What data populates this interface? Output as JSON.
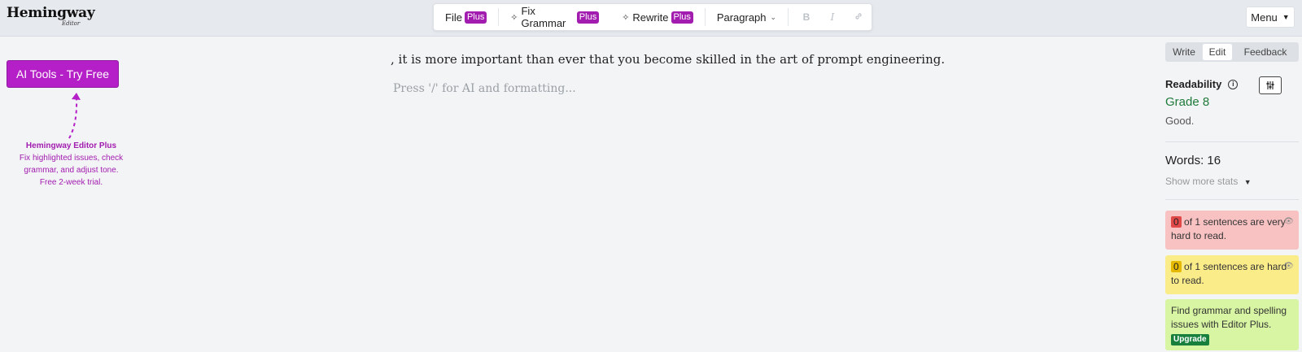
{
  "app": {
    "logo": "Hemingway",
    "logo_sub": "Editor"
  },
  "toolbar": {
    "file": "File",
    "plus": "Plus",
    "fix_grammar": "Fix Grammar",
    "rewrite": "Rewrite",
    "paragraph": "Paragraph",
    "bold": "B",
    "italic": "I",
    "link_icon": "link-icon"
  },
  "menu": {
    "label": "Menu"
  },
  "sidebar_left": {
    "ai_button": "AI Tools - Try Free",
    "promo_title": "Hemingway Editor Plus",
    "promo_lines": [
      "Fix highlighted issues, check",
      "grammar, and adjust tone.",
      "Free 2-week trial."
    ]
  },
  "editor": {
    "text": ", it is more important than ever that you become skilled in the art of prompt engineering.",
    "placeholder": "Press '/' for AI and formatting..."
  },
  "mode_tabs": [
    "Write",
    "Edit",
    "Feedback"
  ],
  "readability": {
    "title": "Readability",
    "grade": "Grade 8",
    "verdict": "Good."
  },
  "stats": {
    "words": "Words: 16",
    "more": "Show more stats"
  },
  "cards": {
    "very_hard": {
      "count": "0",
      "text": "of 1 sentences are very hard to read."
    },
    "hard": {
      "count": "0",
      "text": "of 1 sentences are hard to read."
    },
    "grammar": {
      "text": "Find grammar and spelling issues with Editor Plus.",
      "badge": "Upgrade"
    }
  },
  "colors": {
    "accent": "#b51fc7",
    "grade_green": "#1f7a3a",
    "red_card": "#f8c2c2",
    "yellow_card": "#fbec8a",
    "green_card": "#d7f5a2"
  }
}
